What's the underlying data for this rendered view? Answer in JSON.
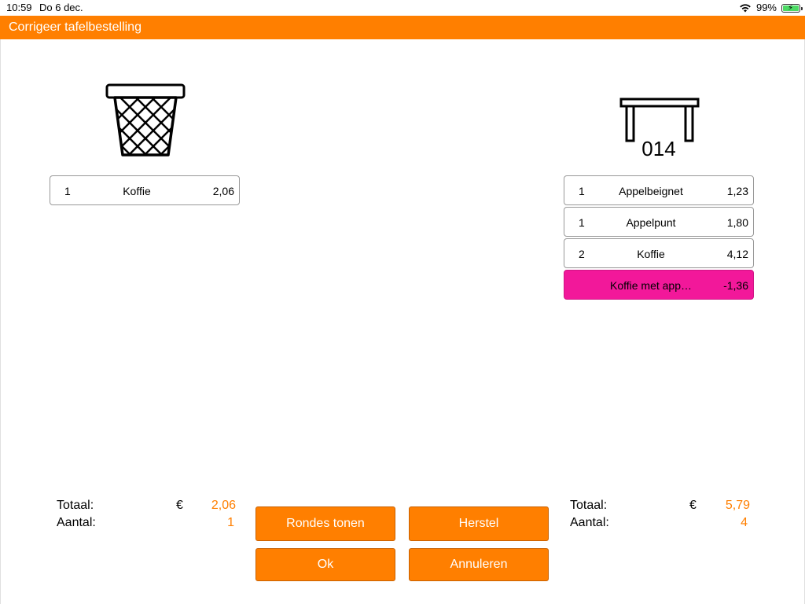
{
  "status_bar": {
    "time": "10:59",
    "date": "Do 6 dec.",
    "battery": "99%",
    "battery_level": 0.99,
    "icons": [
      "wifi-icon",
      "battery-icon"
    ]
  },
  "title": "Corrigeer tafelbestelling",
  "colors": {
    "accent": "#ff7f00",
    "highlight_row": "#f2189a"
  },
  "left": {
    "icon": "wastebasket-icon",
    "items": [
      {
        "qty": "1",
        "name": "Koffie",
        "price": "2,06"
      }
    ],
    "totals": {
      "total_label": "Totaal:",
      "currency": "€",
      "total_value": "2,06",
      "count_label": "Aantal:",
      "count_value": "1"
    }
  },
  "right": {
    "icon": "table-icon",
    "table_number": "014",
    "items": [
      {
        "qty": "1",
        "name": "Appelbeignet",
        "price": "1,23"
      },
      {
        "qty": "1",
        "name": "Appelpunt",
        "price": "1,80"
      },
      {
        "qty": "2",
        "name": "Koffie",
        "price": "4,12"
      },
      {
        "qty": "",
        "name": "Koffie met app…",
        "price": "-1,36"
      }
    ],
    "totals": {
      "total_label": "Totaal:",
      "currency": "€",
      "total_value": "5,79",
      "count_label": "Aantal:",
      "count_value": "4"
    }
  },
  "buttons": {
    "show_rounds": "Rondes tonen",
    "restore": "Herstel",
    "ok": "Ok",
    "cancel": "Annuleren"
  }
}
